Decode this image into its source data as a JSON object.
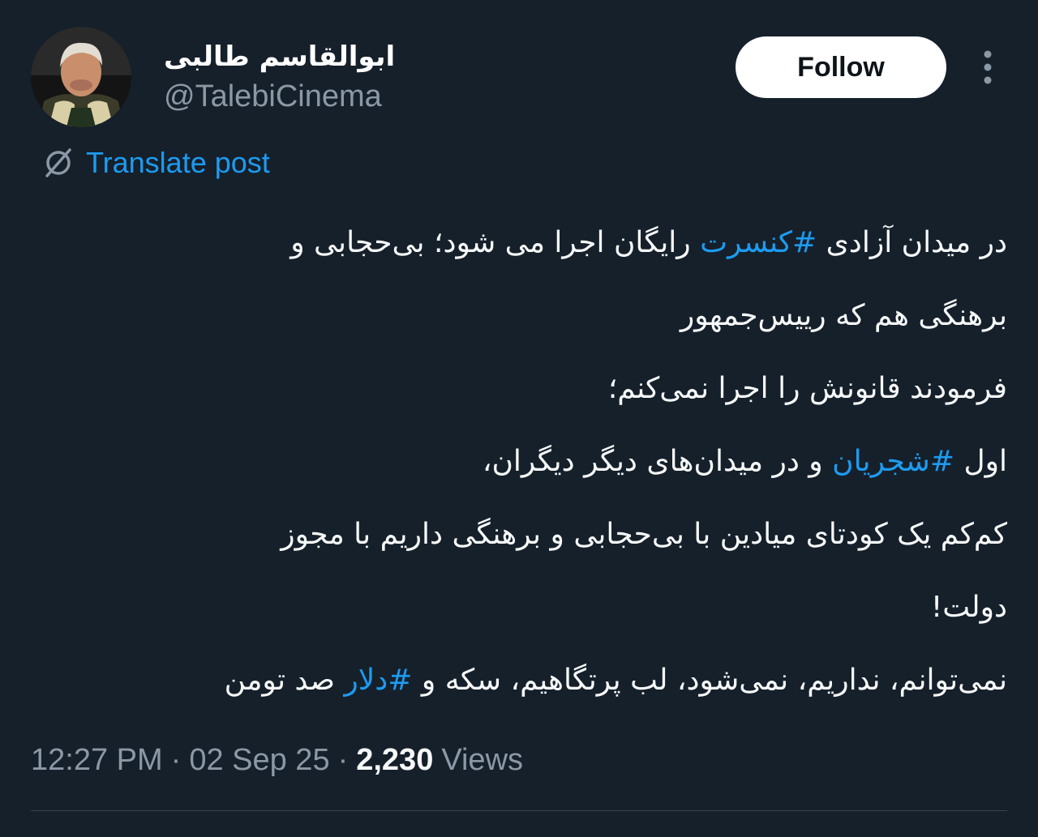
{
  "author": {
    "display_name": "ابوالقاسم طالبی",
    "handle": "@TalebiCinema",
    "avatar_icon": "user-avatar"
  },
  "actions": {
    "follow_label": "Follow",
    "more_icon": "more-vertical-icon"
  },
  "translate": {
    "label": "Translate post",
    "icon": "translate-globe-icon"
  },
  "tweet": {
    "line1": {
      "pre": "در میدان آزادی ",
      "hashtag": "#کنسرت",
      "post": " رایگان اجرا می شود؛ بی‌حجابی و"
    },
    "line2": "برهنگی هم که رییس‌جمهور",
    "line3": " فرمودند قانونش را اجرا نمی‌کنم؛",
    "line4": {
      "pre": "اول ",
      "hashtag": "#شجریان",
      "post": " و در میدان‌های دیگر دیگران،"
    },
    "line5": "کم‌کم یک کودتای میادین با بی‌حجابی و برهنگی داریم با مجوز",
    "line6": "دولت!",
    "line7": {
      "pre": "نمی‌توانم، نداریم، نمی‌شود، لب پرتگاهیم، سکه و ",
      "hashtag": "#دلار",
      "post": " صد تومن"
    }
  },
  "meta": {
    "time": "12:27 PM",
    "separator": "·",
    "date": "02 Sep 25",
    "views_count": "2,230",
    "views_label": "Views"
  },
  "colors": {
    "background": "#15202b",
    "accent": "#1d9bf0",
    "secondary_text": "#8b98a5",
    "primary_text": "#f7f9f9"
  }
}
